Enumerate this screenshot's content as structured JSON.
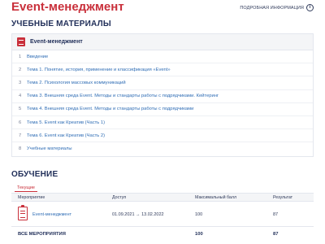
{
  "header": {
    "title": "Event-менеджмент",
    "more_info": "ПОДРОБНАЯ ИНФОРМАЦИЯ",
    "info_icon": "i"
  },
  "materials": {
    "section_title": "УЧЕБНЫЕ МАТЕРИАЛЫ",
    "header_label": "Event-менеджмент",
    "items": [
      {
        "num": "1",
        "label": "Введение"
      },
      {
        "num": "2",
        "label": "Тема 1. Понятие, история, применение и классификация «Event»"
      },
      {
        "num": "3",
        "label": "Тема 2. Психология массовых коммуникаций"
      },
      {
        "num": "4",
        "label": "Тема 3. Внешняя среда Event. Методы и стандарты работы с подрядчиками. Кейтеринг"
      },
      {
        "num": "5",
        "label": "Тема 4. Внешняя среда Event. Методы и стандарты работы с подрядчиками"
      },
      {
        "num": "6",
        "label": "Тема 5. Event как Креатив (Часть 1)"
      },
      {
        "num": "7",
        "label": "Тема 6. Event как Креатив (Часть 2)"
      },
      {
        "num": "8",
        "label": "Учебные материалы"
      }
    ]
  },
  "training": {
    "section_title": "ОБУЧЕНИЕ",
    "tab_current": "Текущие",
    "columns": {
      "event": "Мероприятие",
      "access": "Доступ",
      "max_score": "Максимальный балл",
      "result": "Результат"
    },
    "row": {
      "event": "Event-менеджмент",
      "access": "01.09.2021 → 13.02.2022",
      "max_score": "100",
      "result": "87"
    },
    "total": {
      "label": "ВСЕ МЕРОПРИЯТИЯ",
      "max_score": "100",
      "result": "87"
    }
  },
  "colors": {
    "accent_red": "#c9303b",
    "heading_navy": "#22305a",
    "link_blue": "#2f6db5"
  }
}
